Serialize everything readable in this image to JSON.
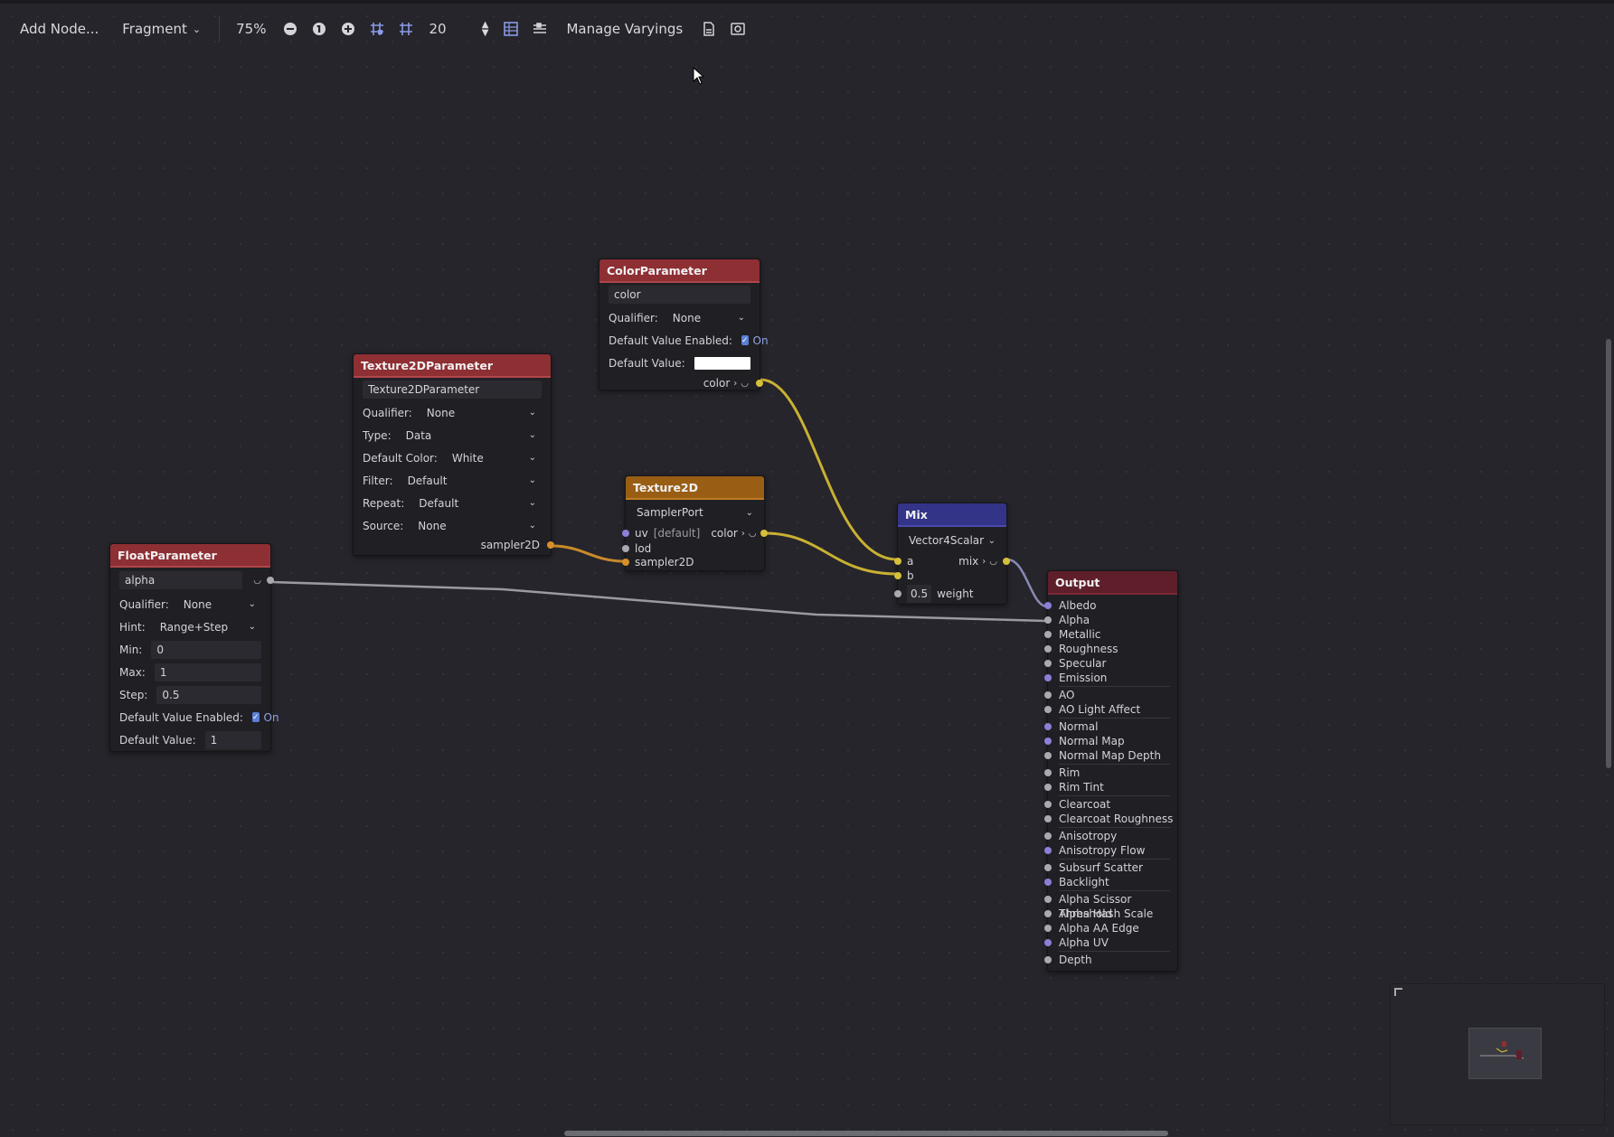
{
  "toolbar": {
    "add_node": "Add Node...",
    "shader_mode": "Fragment",
    "zoom": "75%",
    "snap_distance": "20",
    "manage_varyings": "Manage Varyings"
  },
  "colors": {
    "param_header": "#8e2f33",
    "texture_header": "#995e14",
    "mix_header": "#333388",
    "output_header": "#5e1f2a",
    "wire_yellow": "#c9b032",
    "wire_orange": "#c98a2a",
    "wire_gray": "#9a9aa2"
  },
  "color_param": {
    "title": "ColorParameter",
    "name": "color",
    "qualifier_label": "Qualifier:",
    "qualifier": "None",
    "default_enabled_label": "Default Value Enabled:",
    "default_enabled": "On",
    "default_value_label": "Default Value:",
    "default_value_color": "#ffffff",
    "output": "color"
  },
  "tex_param": {
    "title": "Texture2DParameter",
    "name": "Texture2DParameter",
    "qualifier_label": "Qualifier:",
    "qualifier": "None",
    "type_label": "Type:",
    "type": "Data",
    "default_color_label": "Default Color:",
    "default_color": "White",
    "filter_label": "Filter:",
    "filter": "Default",
    "repeat_label": "Repeat:",
    "repeat": "Default",
    "source_label": "Source:",
    "source": "None",
    "output": "sampler2D"
  },
  "texture2d": {
    "title": "Texture2D",
    "source": "SamplerPort",
    "uv": "uv",
    "uv_default": "[default]",
    "color_out": "color",
    "lod": "lod",
    "sampler": "sampler2D"
  },
  "mix": {
    "title": "Mix",
    "mode": "Vector4Scalar",
    "a": "a",
    "mix_out": "mix",
    "b": "b",
    "weight_value": "0.5",
    "weight": "weight"
  },
  "float_param": {
    "title": "FloatParameter",
    "name": "alpha",
    "qualifier_label": "Qualifier:",
    "qualifier": "None",
    "hint_label": "Hint:",
    "hint": "Range+Step",
    "min_label": "Min:",
    "min": "0",
    "max_label": "Max:",
    "max": "1",
    "step_label": "Step:",
    "step": "0.5",
    "default_enabled_label": "Default Value Enabled:",
    "default_enabled": "On",
    "default_value_label": "Default Value:",
    "default_value": "1"
  },
  "output": {
    "title": "Output",
    "groups": [
      [
        {
          "label": "Albedo",
          "port": "purple"
        },
        {
          "label": "Alpha",
          "port": "gray"
        },
        {
          "label": "Metallic",
          "port": "gray"
        },
        {
          "label": "Roughness",
          "port": "gray"
        },
        {
          "label": "Specular",
          "port": "gray"
        },
        {
          "label": "Emission",
          "port": "purple"
        }
      ],
      [
        {
          "label": "AO",
          "port": "gray"
        },
        {
          "label": "AO Light Affect",
          "port": "gray"
        }
      ],
      [
        {
          "label": "Normal",
          "port": "purple"
        },
        {
          "label": "Normal Map",
          "port": "purple"
        },
        {
          "label": "Normal Map Depth",
          "port": "gray"
        }
      ],
      [
        {
          "label": "Rim",
          "port": "gray"
        },
        {
          "label": "Rim Tint",
          "port": "gray"
        }
      ],
      [
        {
          "label": "Clearcoat",
          "port": "gray"
        },
        {
          "label": "Clearcoat Roughness",
          "port": "gray"
        }
      ],
      [
        {
          "label": "Anisotropy",
          "port": "gray"
        },
        {
          "label": "Anisotropy Flow",
          "port": "purple"
        }
      ],
      [
        {
          "label": "Subsurf Scatter",
          "port": "gray"
        },
        {
          "label": "Backlight",
          "port": "purple"
        }
      ],
      [
        {
          "label": "Alpha Scissor Threshold",
          "port": "gray"
        },
        {
          "label": "Alpha Hash Scale",
          "port": "gray"
        },
        {
          "label": "Alpha AA Edge",
          "port": "gray"
        },
        {
          "label": "Alpha UV",
          "port": "purple"
        }
      ],
      [
        {
          "label": "Depth",
          "port": "gray"
        }
      ]
    ]
  }
}
